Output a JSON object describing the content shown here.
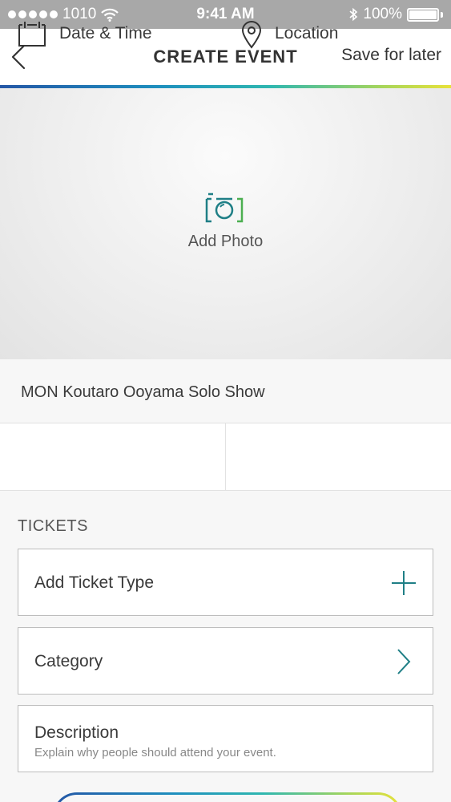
{
  "status_bar": {
    "carrier": "1010",
    "time": "9:41 AM",
    "battery": "100%"
  },
  "nav": {
    "title": "CREATE EVENT",
    "save_later": "Save for later"
  },
  "photo": {
    "label": "Add Photo"
  },
  "event": {
    "name": "MON Koutaro Ooyama Solo Show",
    "date_time_label": "Date & Time",
    "location_label": "Location"
  },
  "tickets": {
    "heading": "TICKETS",
    "add_ticket_type": "Add Ticket Type",
    "category": "Category",
    "description_title": "Description",
    "description_hint": "Explain why people should attend your event."
  },
  "colors": {
    "accent_teal": "#1f7f86",
    "accent_green": "#4caf50",
    "accent_gradient": [
      "#2457a6",
      "#1e8fbe",
      "#2fb7b0",
      "#a8d65a",
      "#e8e23a"
    ]
  },
  "icons": {
    "back": "chevron-left-icon",
    "camera": "camera-icon",
    "calendar": "calendar-icon",
    "location": "location-pin-icon",
    "add": "plus-icon",
    "chevron": "chevron-right-icon"
  }
}
